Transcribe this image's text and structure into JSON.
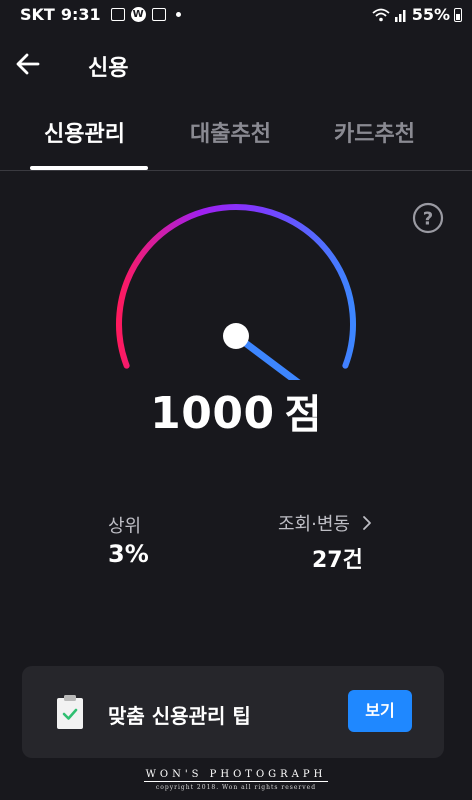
{
  "status_bar": {
    "carrier": "SKT",
    "time": "9:31",
    "notification_badge": "W",
    "battery": "55%"
  },
  "header": {
    "title": "신용",
    "back_icon": "arrow-left-icon"
  },
  "tabs": [
    {
      "label": "신용관리",
      "active": true
    },
    {
      "label": "대출추천",
      "active": false
    },
    {
      "label": "카드추천",
      "active": false
    }
  ],
  "score": {
    "value": "1000",
    "unit": "점",
    "gauge_fraction": 0.97,
    "gradient": [
      "#ff1a5e",
      "#a020f0",
      "#7b3cff",
      "#3d86ff"
    ]
  },
  "rank": {
    "label": "상위",
    "value": "3%"
  },
  "inquiry": {
    "label": "조회·변동",
    "value": "27건"
  },
  "tip_card": {
    "icon": "clipboard-check-icon",
    "text": "맞춤 신용관리 팁",
    "button_label": "보기",
    "button_color": "#1f88ff"
  },
  "watermark": {
    "title": "WON'S PHOTOGRAPH",
    "subtitle": "copyright 2018. Won all rights reserved"
  },
  "colors": {
    "background": "#18181d",
    "card_background": "#26262b",
    "inactive_tab": "#8a8a92"
  }
}
